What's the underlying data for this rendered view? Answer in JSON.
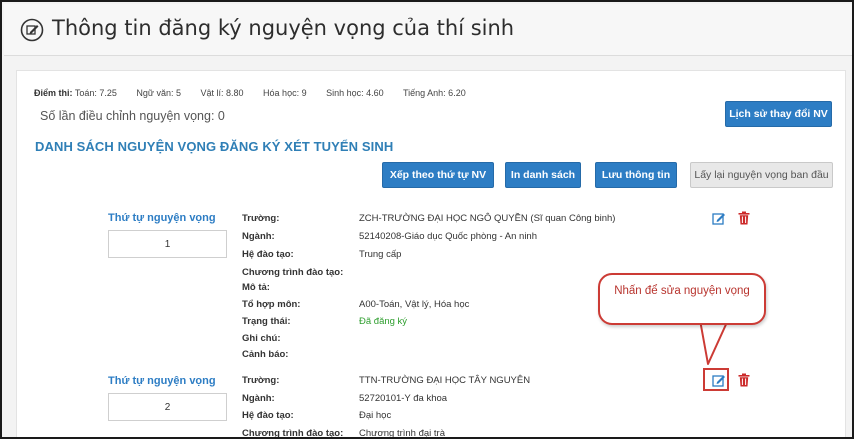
{
  "header": {
    "title": "Thông tin đăng ký nguyện vọng của thí sinh"
  },
  "scores": {
    "label": "Điểm thi:",
    "items": [
      "Toán: 7.25",
      "Ngữ văn: 5",
      "Vật lí: 8.80",
      "Hóa học: 9",
      "Sinh học: 4.60",
      "Tiếng Anh: 6.20"
    ]
  },
  "adjust_text": "Số lần điều chỉnh nguyện vọng: 0",
  "history_button": "Lịch sử thay đổi NV",
  "section_title": "DANH SÁCH NGUYỆN VỌNG ĐĂNG KÝ XÉT TUYỂN SINH",
  "toolbar": {
    "sort": "Xếp theo thứ tự NV",
    "print": "In danh sách",
    "save": "Lưu thông tin",
    "reset": "Lấy lại nguyện vọng ban đầu"
  },
  "labels": {
    "order": "Thứ tự nguyện vọng",
    "school": "Trường:",
    "major": "Ngành:",
    "system": "Hệ đào tạo:",
    "program": "Chương trình đào tạo:",
    "desc": "Mô tả:",
    "combo": "Tổ hợp môn:",
    "status": "Trạng thái:",
    "note": "Ghi chú:",
    "warning": "Cảnh báo:"
  },
  "records": [
    {
      "order": "1",
      "school": "ZCH-TRƯỜNG ĐẠI HỌC NGÔ QUYỀN (Sĩ quan Công binh)",
      "major": "52140208-Giáo dục Quốc phòng - An ninh",
      "system": "Trung cấp",
      "program": "",
      "desc": "",
      "combo": "A00-Toán, Vật lý, Hóa học",
      "status": "Đã đăng ký",
      "note": "",
      "warning": ""
    },
    {
      "order": "2",
      "school": "TTN-TRƯỜNG ĐẠI HỌC TÂY NGUYÊN",
      "major": "52720101-Y đa khoa",
      "system": "Đại học",
      "program": "Chương trình đại trà"
    }
  ],
  "callout": {
    "text": "Nhấn để sửa nguyện vọng"
  },
  "colors": {
    "accent": "#2d7dc4",
    "danger": "#cc2a2a",
    "success": "#2e9e2e",
    "callout": "#cc3b35"
  }
}
